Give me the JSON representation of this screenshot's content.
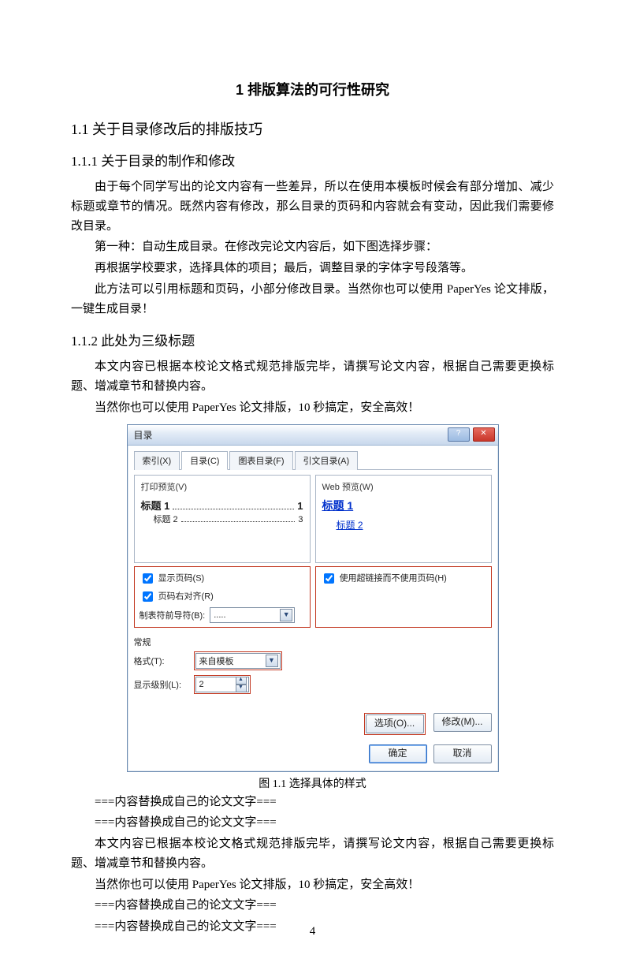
{
  "chapter_title": "1  排版算法的可行性研究",
  "sec_1_1": "1.1  关于目录修改后的排版技巧",
  "sec_1_1_1": "1.1.1  关于目录的制作和修改",
  "p1": "由于每个同学写出的论文内容有一些差异，所以在使用本模板时候会有部分增加、减少标题或章节的情况。既然内容有修改，那么目录的页码和内容就会有变动，因此我们需要修改目录。",
  "p2": "第一种：自动生成目录。在修改完论文内容后，如下图选择步骤：",
  "p3": "再根据学校要求，选择具体的项目；最后，调整目录的字体字号段落等。",
  "p4": "此方法可以引用标题和页码，小部分修改目录。当然你也可以使用 PaperYes 论文排版，一键生成目录！",
  "sec_1_1_2": "1.1.2  此处为三级标题",
  "p5": "本文内容已根据本校论文格式规范排版完毕，请撰写论文内容，根据自己需要更换标题、增减章节和替换内容。",
  "p6": "当然你也可以使用 PaperYes 论文排版，10 秒搞定，安全高效！",
  "caption_1_1": "图 1.1  选择具体的样式",
  "p7": "===内容替换成自己的论文文字===",
  "p8": "===内容替换成自己的论文文字===",
  "p9": "本文内容已根据本校论文格式规范排版完毕，请撰写论文内容，根据自己需要更换标题、增减章节和替换内容。",
  "p10": "当然你也可以使用 PaperYes 论文排版，10 秒搞定，安全高效！",
  "p11": "===内容替换成自己的论文文字===",
  "p12": "===内容替换成自己的论文文字===",
  "page_number": "4",
  "dialog": {
    "title": "目录",
    "tabs": [
      "索引(X)",
      "目录(C)",
      "图表目录(F)",
      "引文目录(A)"
    ],
    "print_preview_label": "打印预览(V)",
    "web_preview_label": "Web 预览(W)",
    "toc_h1": "标题 1",
    "toc_h1_page": "1",
    "toc_h2": "标题 2",
    "toc_h2_page": "3",
    "web_h1": "标题 1",
    "web_h2": "标题 2",
    "show_pagenum": "显示页码(S)",
    "right_align": "页码右对齐(R)",
    "tab_leader_label": "制表符前导符(B):",
    "tab_leader_value": ".....",
    "use_hyperlink": "使用超链接而不使用页码(H)",
    "general_label": "常规",
    "format_label": "格式(T):",
    "format_value": "来自模板",
    "levels_label": "显示级别(L):",
    "levels_value": "2",
    "options_btn": "选项(O)...",
    "modify_btn": "修改(M)...",
    "ok_btn": "确定",
    "cancel_btn": "取消"
  }
}
